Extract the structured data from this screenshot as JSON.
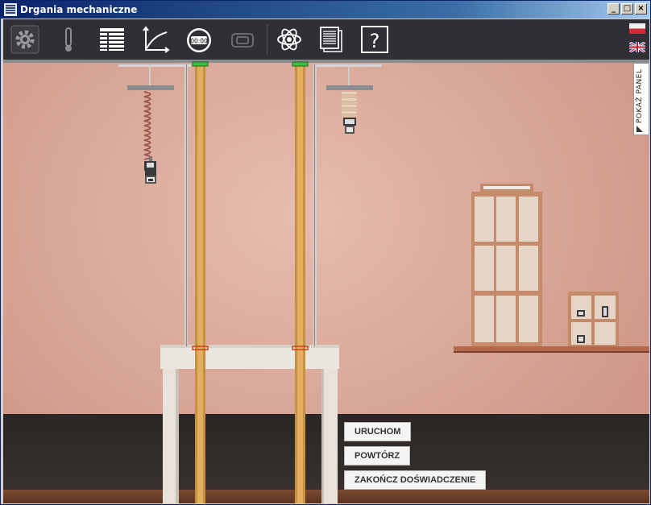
{
  "window": {
    "title": "Drgania mechaniczne",
    "controls": [
      "minimize",
      "maximize",
      "close"
    ]
  },
  "toolbar": {
    "icons": [
      "gear-icon",
      "thermometer-icon",
      "table-icon",
      "graph-icon",
      "stopwatch-icon",
      "camera-icon",
      "atom-icon",
      "notebook-icon",
      "help-icon"
    ],
    "stopwatch_text": "00:00",
    "help_text": "?",
    "languages": [
      "pl-flag-icon",
      "uk-flag-icon"
    ]
  },
  "side_panel": {
    "label": "POKAŻ PANEL"
  },
  "actions": {
    "start": "URUCHOM",
    "repeat": "POWTÓRZ",
    "finish": "ZAKOŃCZ DOŚWIADCZENIE"
  },
  "colors": {
    "titlebar": "#0a246a",
    "toolbar": "#2f3036",
    "wall": "#d9a898",
    "floor": "#2b2623",
    "ruler": "#e0b060"
  }
}
